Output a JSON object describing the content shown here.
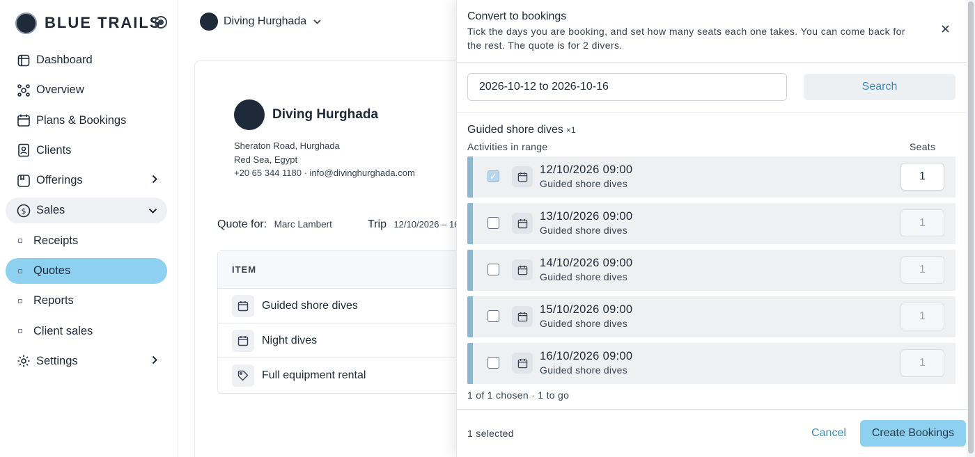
{
  "brand": {
    "name": "BLUE TRAILS",
    "logo_text": "BLUE TRAILS"
  },
  "sidebar": {
    "items": [
      {
        "label": "Dashboard",
        "icon": "grid-icon"
      },
      {
        "label": "Overview",
        "icon": "nodes-icon"
      },
      {
        "label": "Plans & Bookings",
        "icon": "calendar-icon"
      },
      {
        "label": "Clients",
        "icon": "contacts-icon"
      },
      {
        "label": "Offerings",
        "icon": "package-icon"
      },
      {
        "label": "Sales",
        "icon": "dollar-icon"
      },
      {
        "label": "Receipts"
      },
      {
        "label": "Quotes"
      },
      {
        "label": "Reports"
      },
      {
        "label": "Client sales"
      },
      {
        "label": "Settings",
        "icon": "gear-icon"
      }
    ]
  },
  "topbar": {
    "org_name": "Diving Hurghada"
  },
  "quote": {
    "business_name": "Diving Hurghada",
    "address_line1": "Sheraton Road, Hurghada",
    "address_line2": "Red Sea, Egypt",
    "contact": "+20 65 344 1180 · info@divinghurghada.com",
    "quote_for_label": "Quote for:",
    "customer": "Marc Lambert",
    "trip_label": "Trip",
    "trip_dates": "12/10/2026 – 16",
    "items_header": "ITEM",
    "items": [
      {
        "name": "Guided shore dives",
        "icon": "calendar-icon"
      },
      {
        "name": "Night dives",
        "icon": "calendar-icon"
      },
      {
        "name": "Full equipment rental",
        "icon": "tag-icon"
      }
    ]
  },
  "drawer": {
    "title": "Convert to bookings",
    "description": "Tick the days you are booking, and set how many seats each one takes. You can come back for the rest. The quote is for 2 divers.",
    "date_range_value": "2026-10-12 to 2026-10-16",
    "search_label": "Search",
    "group_title": "Guided shore dives",
    "group_multiplier": "×1",
    "col_activities": "Activities in range",
    "col_seats": "Seats",
    "slots": [
      {
        "date": "12/10/2026",
        "time": "09:00",
        "activity": "Guided shore dives",
        "seats": "1",
        "checked": true
      },
      {
        "date": "13/10/2026",
        "time": "09:00",
        "activity": "Guided shore dives",
        "seats": "1",
        "checked": false
      },
      {
        "date": "14/10/2026",
        "time": "09:00",
        "activity": "Guided shore dives",
        "seats": "1",
        "checked": false
      },
      {
        "date": "15/10/2026",
        "time": "09:00",
        "activity": "Guided shore dives",
        "seats": "1",
        "checked": false
      },
      {
        "date": "16/10/2026",
        "time": "09:00",
        "activity": "Guided shore dives",
        "seats": "1",
        "checked": false
      }
    ],
    "summary": "1 of 1 chosen · 1 to go",
    "selected_count": "1 selected",
    "cancel_label": "Cancel",
    "create_label": "Create Bookings"
  },
  "colors": {
    "accent": "#8ed0f0",
    "link": "#3f8bbd",
    "slot_bar": "#8fb6cf"
  }
}
